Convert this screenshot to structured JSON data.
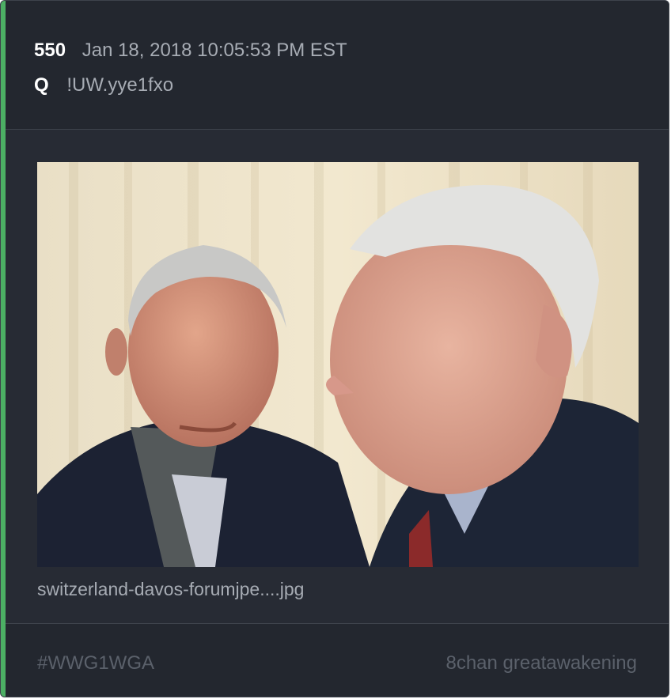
{
  "post": {
    "number": "550",
    "date": "Jan 18, 2018 10:05:53 PM EST",
    "author": "Q",
    "tripcode": "!UW.yye1fxo"
  },
  "attachment": {
    "filename": "switzerland-davos-forumjpe....jpg"
  },
  "footer": {
    "hashtag": "#WWG1WGA",
    "source": "8chan greatawakening"
  },
  "colors": {
    "accent": "#4caf64",
    "card_background": "#272b34",
    "header_background": "#23272f",
    "muted_text": "#a7acb4",
    "footer_text": "#5b616b"
  }
}
